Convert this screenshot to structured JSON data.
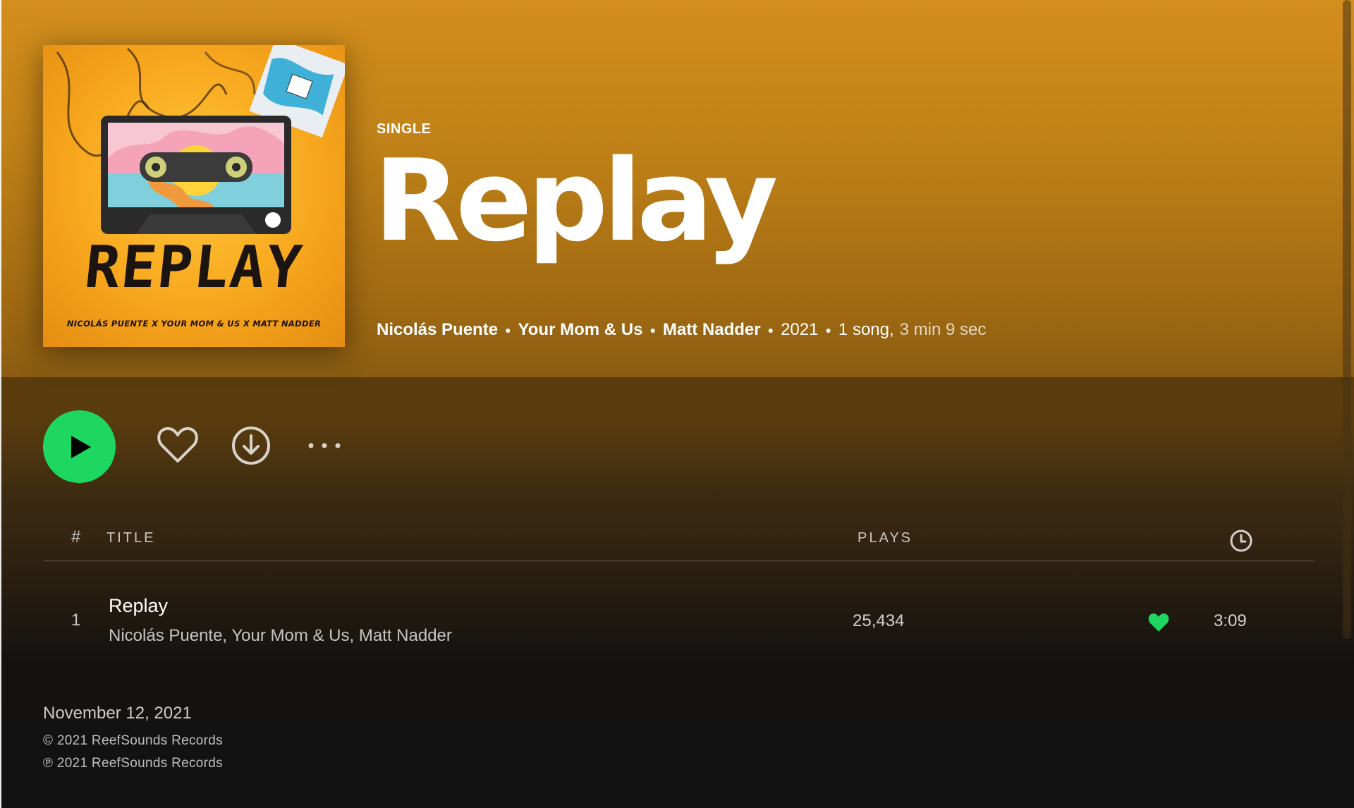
{
  "album": {
    "type_label": "SINGLE",
    "title": "Replay",
    "cover": {
      "art_title": "REPLAY",
      "art_credits": "NICOLÁS PUENTE X YOUR MOM & US X MATT NADDER"
    },
    "artists": [
      "Nicolás Puente",
      "Your Mom & Us",
      "Matt Nadder"
    ],
    "year": "2021",
    "song_count": "1 song,",
    "duration": "3 min 9 sec"
  },
  "actions": {
    "play_icon": "play-icon",
    "like_icon": "heart-outline-icon",
    "download_icon": "download-icon",
    "more_icon": "more-options-icon"
  },
  "table": {
    "headers": {
      "num": "#",
      "title": "TITLE",
      "plays": "PLAYS",
      "duration_icon": "clock-icon"
    },
    "tracks": [
      {
        "number": "1",
        "title": "Replay",
        "artists": "Nicolás Puente, Your Mom & Us, Matt Nadder",
        "plays": "25,434",
        "liked": true,
        "duration": "3:09"
      }
    ]
  },
  "footer": {
    "release_date": "November 12, 2021",
    "copyright": "© 2021 ReefSounds Records",
    "phonogram": "℗ 2021 ReefSounds Records"
  },
  "colors": {
    "accent_green": "#1ed760",
    "header_gold": "#d58e1c",
    "background": "#121212"
  }
}
